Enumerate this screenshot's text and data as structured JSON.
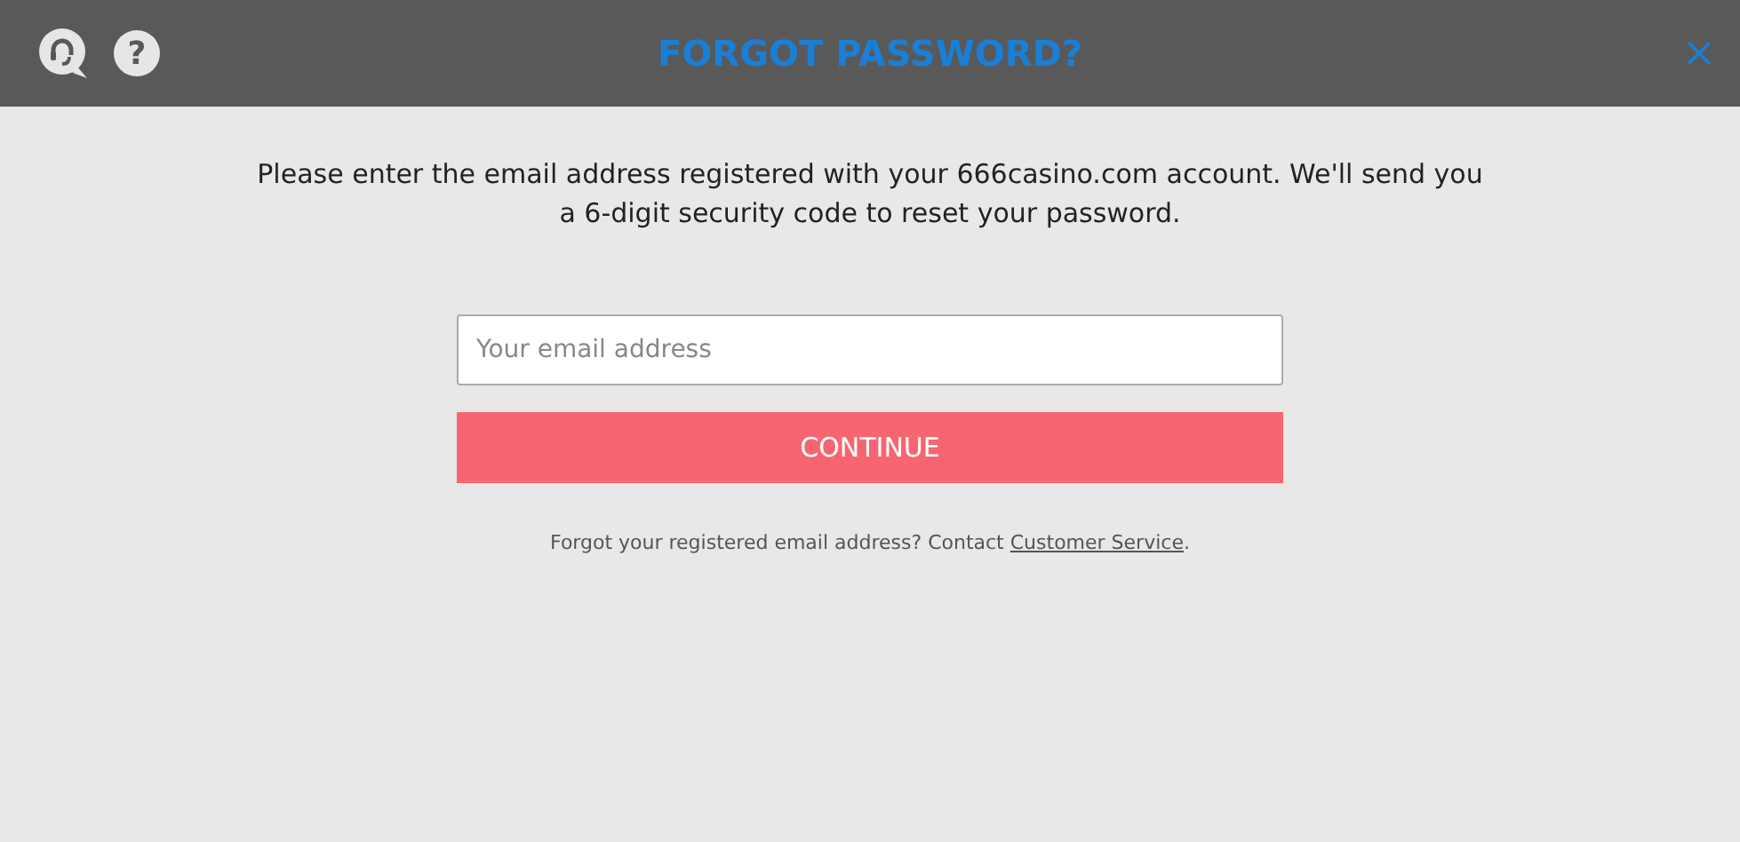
{
  "header": {
    "title": "FORGOT PASSWORD?",
    "help_icon_text": "?"
  },
  "instructions": "Please enter the email address registered with your 666casino.com account. We'll send you a 6-digit security code to reset your password.",
  "email_field": {
    "placeholder": "Your email address"
  },
  "continue_button": "CONTINUE",
  "footer": {
    "text": "Forgot your registered email address? Contact ",
    "link": "Customer Service",
    "end": "."
  }
}
